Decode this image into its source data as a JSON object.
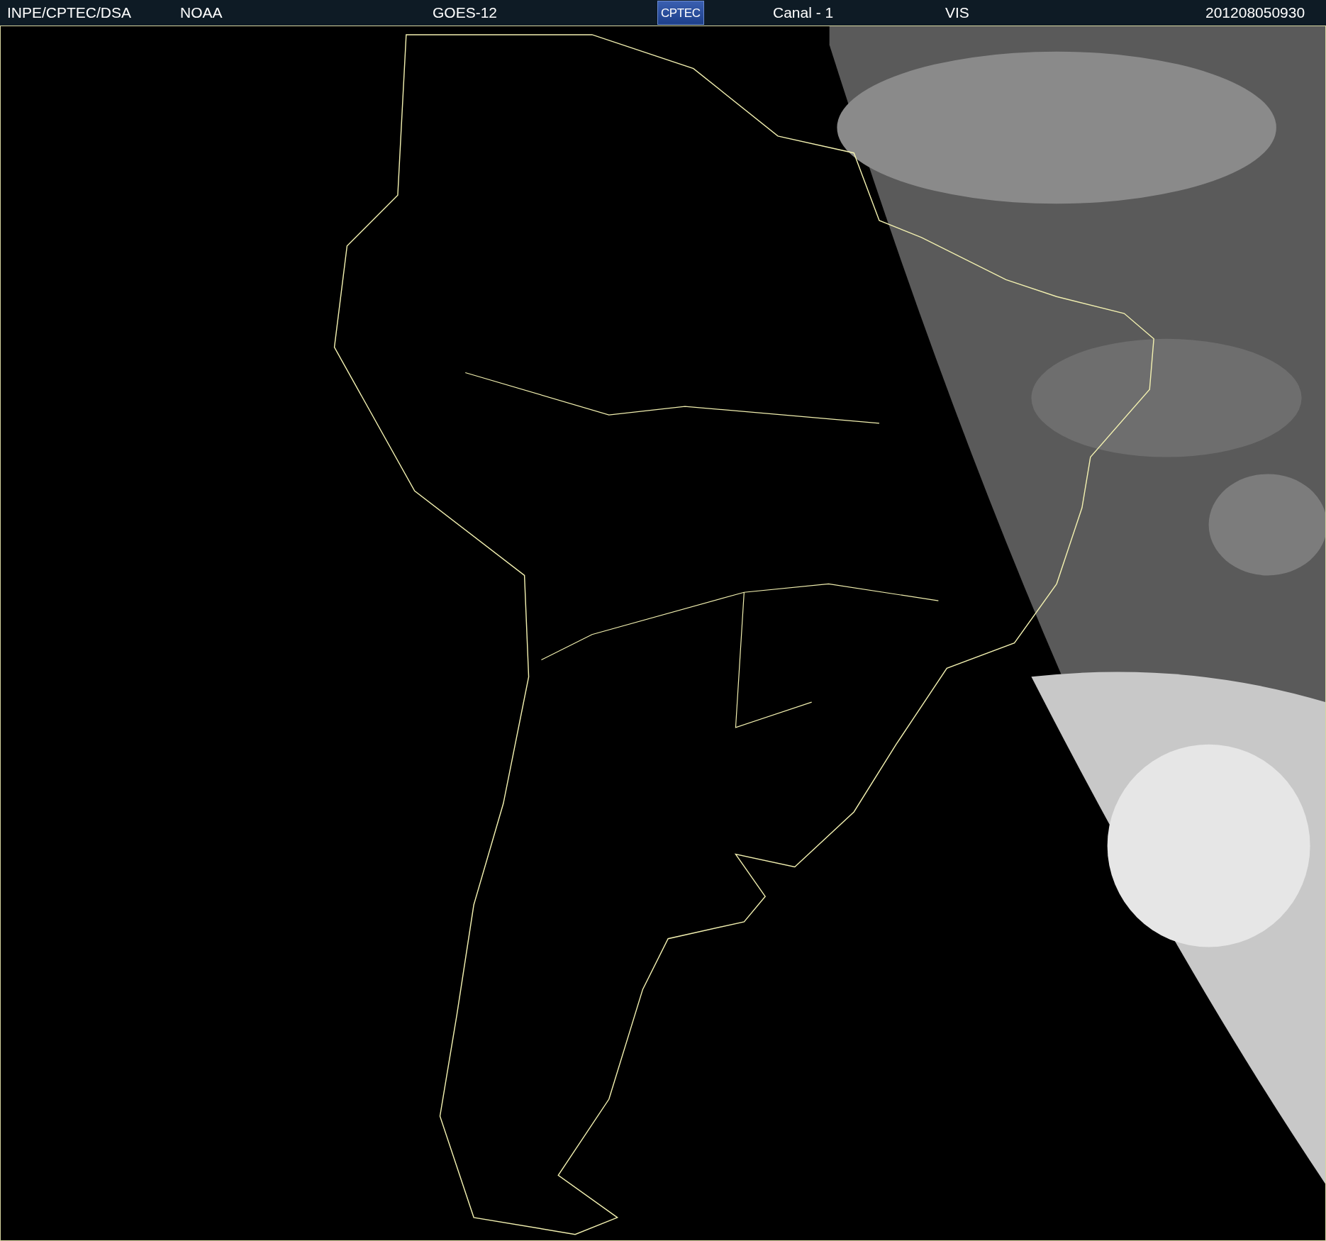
{
  "header": {
    "items": [
      {
        "kind": "text",
        "text": "INPE/CPTEC/DSA"
      },
      {
        "kind": "text",
        "text": "NOAA"
      },
      {
        "kind": "text",
        "text": "GOES-12"
      },
      {
        "kind": "logo",
        "text": "CPTEC"
      },
      {
        "kind": "text",
        "text": "Canal - 1"
      },
      {
        "kind": "text",
        "text": "VIS"
      },
      {
        "kind": "text",
        "text": "201208050930"
      }
    ]
  }
}
